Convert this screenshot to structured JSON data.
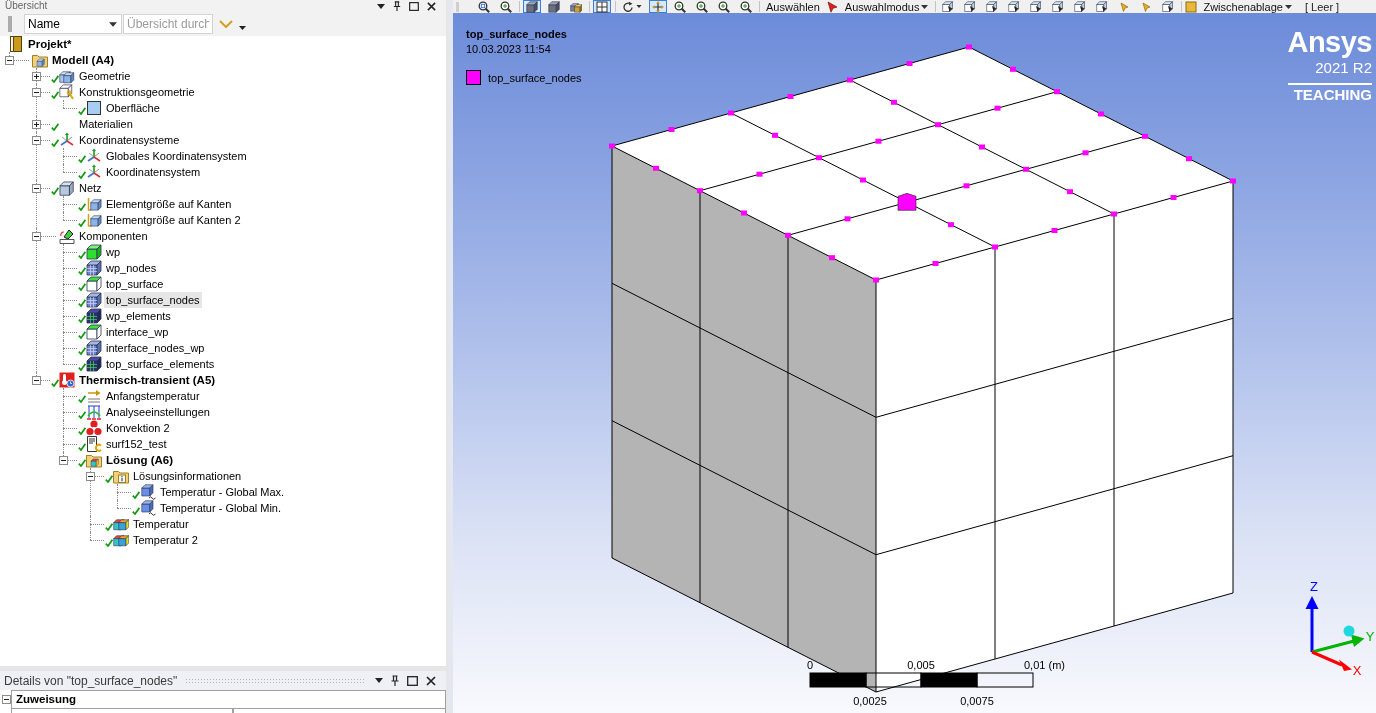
{
  "outline": {
    "title": "Übersicht",
    "filter": {
      "value": "Name"
    },
    "search": {
      "placeholder": "Übersicht durch"
    },
    "tree": [
      {
        "label": "Projekt*",
        "kind": "project",
        "bold": true,
        "checked": false,
        "selected": false,
        "children": [
          {
            "label": "Modell (A4)",
            "kind": "model",
            "bold": true,
            "checked": false,
            "selected": false,
            "expanded": true,
            "children": [
              {
                "label": "Geometrie",
                "kind": "geometry",
                "bold": false,
                "checked": true,
                "selected": false,
                "expanded": false
              },
              {
                "label": "Konstruktionsgeometrie",
                "kind": "construction",
                "bold": false,
                "checked": true,
                "selected": false,
                "expanded": true,
                "children": [
                  {
                    "label": "Oberfläche",
                    "kind": "surface",
                    "bold": false,
                    "checked": true,
                    "selected": false
                  }
                ]
              },
              {
                "label": "Materialien",
                "kind": "materials",
                "bold": false,
                "checked": true,
                "selected": false,
                "expanded": false
              },
              {
                "label": "Koordinatensysteme",
                "kind": "coordsystems",
                "bold": false,
                "checked": true,
                "selected": false,
                "expanded": true,
                "children": [
                  {
                    "label": "Globales Koordinatensystem",
                    "kind": "coordsystem",
                    "bold": false,
                    "checked": true,
                    "selected": false
                  },
                  {
                    "label": "Koordinatensystem",
                    "kind": "coordsystem",
                    "bold": false,
                    "checked": true,
                    "selected": false
                  }
                ]
              },
              {
                "label": "Netz",
                "kind": "mesh",
                "bold": false,
                "checked": true,
                "selected": false,
                "expanded": true,
                "children": [
                  {
                    "label": "Elementgröße auf Kanten",
                    "kind": "sizing",
                    "bold": false,
                    "checked": true,
                    "selected": false
                  },
                  {
                    "label": "Elementgröße auf Kanten 2",
                    "kind": "sizing",
                    "bold": false,
                    "checked": true,
                    "selected": false
                  }
                ]
              },
              {
                "label": "Komponenten",
                "kind": "components",
                "bold": false,
                "checked": false,
                "selected": false,
                "expanded": true,
                "children": [
                  {
                    "label": "wp",
                    "kind": "body",
                    "bold": false,
                    "checked": true,
                    "selected": false
                  },
                  {
                    "label": "wp_nodes",
                    "kind": "nodes",
                    "bold": false,
                    "checked": true,
                    "selected": false
                  },
                  {
                    "label": "top_surface",
                    "kind": "face",
                    "bold": false,
                    "checked": true,
                    "selected": false
                  },
                  {
                    "label": "top_surface_nodes",
                    "kind": "nodes",
                    "bold": false,
                    "checked": true,
                    "selected": true
                  },
                  {
                    "label": "wp_elements",
                    "kind": "elements",
                    "bold": false,
                    "checked": true,
                    "selected": false
                  },
                  {
                    "label": "interface_wp",
                    "kind": "face",
                    "bold": false,
                    "checked": true,
                    "selected": false
                  },
                  {
                    "label": "interface_nodes_wp",
                    "kind": "nodes",
                    "bold": false,
                    "checked": true,
                    "selected": false
                  },
                  {
                    "label": "top_surface_elements",
                    "kind": "elements",
                    "bold": false,
                    "checked": true,
                    "selected": false
                  }
                ]
              },
              {
                "label": "Thermisch-transient (A5)",
                "kind": "analysis",
                "bold": true,
                "checked": true,
                "selected": false,
                "expanded": true,
                "children": [
                  {
                    "label": "Anfangstemperatur",
                    "kind": "initialtemp",
                    "bold": false,
                    "checked": true,
                    "selected": false
                  },
                  {
                    "label": "Analyseeinstellungen",
                    "kind": "settings",
                    "bold": false,
                    "checked": true,
                    "selected": false
                  },
                  {
                    "label": "Konvektion 2",
                    "kind": "convection",
                    "bold": false,
                    "checked": true,
                    "selected": false
                  },
                  {
                    "label": "surf152_test",
                    "kind": "command",
                    "bold": false,
                    "checked": true,
                    "selected": false
                  },
                  {
                    "label": "Lösung (A6)",
                    "kind": "solution",
                    "bold": true,
                    "checked": true,
                    "selected": false,
                    "expanded": true,
                    "children": [
                      {
                        "label": "Lösungsinformationen",
                        "kind": "solutioninfo",
                        "bold": false,
                        "checked": true,
                        "selected": false,
                        "expanded": true,
                        "children": [
                          {
                            "label": "Temperatur - Global Max.",
                            "kind": "tracker",
                            "bold": false,
                            "checked": true,
                            "selected": false
                          },
                          {
                            "label": "Temperatur - Global Min.",
                            "kind": "tracker",
                            "bold": false,
                            "checked": true,
                            "selected": false
                          }
                        ]
                      },
                      {
                        "label": "Temperatur",
                        "kind": "result",
                        "bold": false,
                        "checked": true,
                        "selected": false
                      },
                      {
                        "label": "Temperatur 2",
                        "kind": "result",
                        "bold": false,
                        "checked": true,
                        "selected": false
                      }
                    ]
                  }
                ]
              }
            ]
          }
        ]
      }
    ]
  },
  "details": {
    "title": "Details von \"top_surface_nodes\"",
    "sections": [
      {
        "label": "Zuweisung",
        "expanded": true
      }
    ]
  },
  "toolbar": {
    "tools": [
      {
        "kind": "zoomfit",
        "on": false
      },
      {
        "kind": "zoom",
        "on": false
      },
      {
        "kind": "separator"
      },
      {
        "kind": "cube",
        "on": true
      },
      {
        "kind": "cube",
        "on": false
      },
      {
        "kind": "cubes",
        "on": false
      },
      {
        "kind": "separator"
      },
      {
        "kind": "grid",
        "on": true
      },
      {
        "kind": "separator"
      },
      {
        "kind": "rotate",
        "on": false
      },
      {
        "kind": "pan",
        "on": true
      },
      {
        "kind": "zoom",
        "on": false
      },
      {
        "kind": "zoom",
        "on": false
      },
      {
        "kind": "zoom",
        "on": false
      },
      {
        "kind": "zoom",
        "on": false
      },
      {
        "kind": "separator"
      },
      {
        "kind": "button",
        "label": "Auswählen"
      },
      {
        "kind": "cursor"
      },
      {
        "kind": "menu",
        "label": "Auswahlmodus"
      },
      {
        "kind": "separator"
      },
      {
        "kind": "select",
        "on": false
      },
      {
        "kind": "select",
        "on": false
      },
      {
        "kind": "select",
        "on": false
      },
      {
        "kind": "select",
        "on": false
      },
      {
        "kind": "select",
        "on": false
      },
      {
        "kind": "select",
        "on": false
      },
      {
        "kind": "select",
        "on": false
      },
      {
        "kind": "select",
        "on": false
      },
      {
        "kind": "pick",
        "on": false
      },
      {
        "kind": "pick",
        "on": false
      },
      {
        "kind": "select",
        "on": false
      },
      {
        "kind": "separator"
      },
      {
        "kind": "clipboard"
      },
      {
        "kind": "menu",
        "label": "Zwischenablage"
      },
      {
        "kind": "status",
        "label": "[ Leer ]"
      }
    ]
  },
  "graphics": {
    "title": "top_surface_nodes",
    "timestamp": "10.03.2023 11:54",
    "legend": [
      {
        "label": "top_surface_nodes",
        "color": "#ff00ff"
      }
    ],
    "logo": {
      "name": "Ansys",
      "version": "2021 R2",
      "edition": "TEACHING"
    },
    "scale_bar": {
      "top_labels": [
        "0",
        "0,005",
        "0,01 (m)"
      ],
      "bottom_labels": [
        "0,0025",
        "0,0075"
      ]
    },
    "triad": [
      {
        "label": "Z",
        "color": "#0000ff"
      },
      {
        "label": "Y",
        "color": "#00b400"
      },
      {
        "label": "X",
        "color": "#ff0000"
      }
    ]
  }
}
